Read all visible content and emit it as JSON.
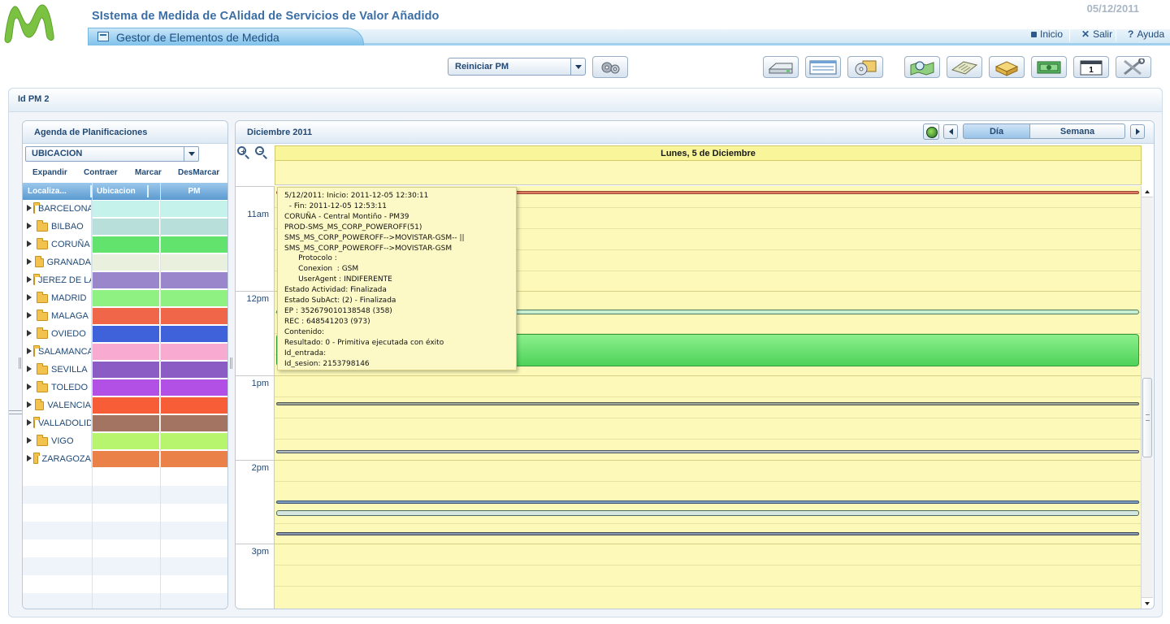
{
  "header": {
    "app_title": "SIstema de Medida de CAlidad de Servicios de Valor Añadido",
    "date": "05/12/2011",
    "module_title": "Gestor de Elementos de Medida",
    "nav": {
      "home": "Inicio",
      "exit": "Salir",
      "help": "Ayuda"
    }
  },
  "toolbar": {
    "action_select": "Reiniciar PM",
    "icons": [
      "gears-icon",
      "drive-icon",
      "form-window-icon",
      "disc-box-icon",
      "map-search-icon",
      "keyboard-icon",
      "box-icon",
      "money-icon",
      "calendar-icon",
      "tools-icon"
    ]
  },
  "pm_bar": {
    "label": "Id PM 2"
  },
  "left_panel": {
    "title": "Agenda de Planificaciones",
    "filter": "UBICACION",
    "actions": {
      "expand": "Expandir",
      "collapse": "Contraer",
      "mark": "Marcar",
      "unmark": "DesMarcar"
    },
    "columns": {
      "location": "Localiza...",
      "ubicacion": "Ubicacion",
      "pm": "PM"
    },
    "rows": [
      {
        "name": "BARCELONA",
        "color": "#c5f3ec"
      },
      {
        "name": "BILBAO",
        "color": "#b9dfda"
      },
      {
        "name": "CORUÑA",
        "color": "#62e36d"
      },
      {
        "name": "GRANADA",
        "color": "#e9f0dd"
      },
      {
        "name": "JEREZ DE LA FRONTERA",
        "color": "#9a87cb"
      },
      {
        "name": "MADRID",
        "color": "#8ff182"
      },
      {
        "name": "MALAGA",
        "color": "#ef6648"
      },
      {
        "name": "OVIEDO",
        "color": "#3f61d9"
      },
      {
        "name": "SALAMANCA",
        "color": "#f9aad0"
      },
      {
        "name": "SEVILLA",
        "color": "#8a5cc4"
      },
      {
        "name": "TOLEDO",
        "color": "#b24fe4"
      },
      {
        "name": "VALENCIA",
        "color": "#f75d37"
      },
      {
        "name": "VALLADOLID",
        "color": "#a47462"
      },
      {
        "name": "VIGO",
        "color": "#b8f56e"
      },
      {
        "name": "ZARAGOZA",
        "color": "#e98149"
      }
    ]
  },
  "calendar": {
    "title": "Diciembre 2011",
    "tabs": {
      "day": "Día",
      "week": "Semana"
    },
    "day_header": "Lunes, 5 de Diciembre",
    "hours": [
      "11am",
      "12pm",
      "1pm",
      "2pm",
      "3pm"
    ],
    "tooltip": "5/12/2011: Inicio: 2011-12-05 12:30:11\n  - Fin: 2011-12-05 12:53:11\nCORUÑA - Central Montiño - PM39\nPROD-SMS_MS_CORP_POWEROFF(51)\nSMS_MS_CORP_POWEROFF-->MOVISTAR-GSM-- ||\nSMS_MS_CORP_POWEROFF-->MOVISTAR-GSM\n      Protocolo :\n      Conexion  : GSM\n      UserAgent : INDIFERENTE\nEstado Actividad: Finalizada\nEstado SubAct: (2) - Finalizada\nEP : 352679010138548 (358)\nREC : 648541203 (973)\nContenido:\nResultado: 0 - Primitiva ejecutada con éxito\nId_entrada:\nId_sesion: 2153798146"
  }
}
